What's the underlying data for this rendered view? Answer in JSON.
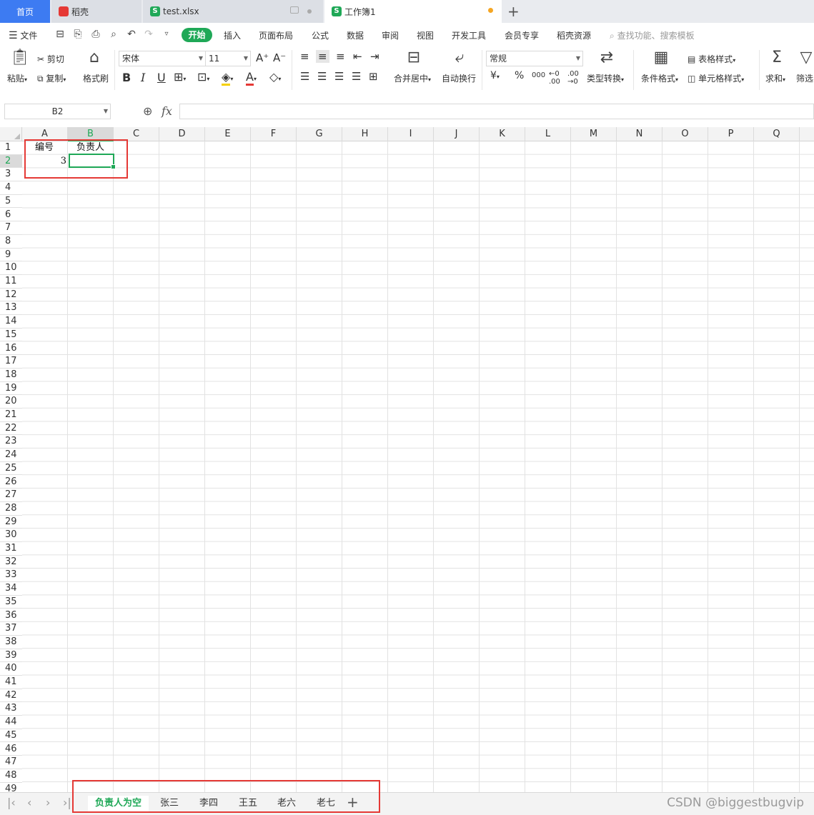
{
  "window_tabs": [
    {
      "label": "首页",
      "icon": "",
      "active": false
    },
    {
      "label": "稻壳",
      "icon": "daoke-icon",
      "active": false
    },
    {
      "label": "test.xlsx",
      "icon": "spreadsheet-icon",
      "active": false
    },
    {
      "label": "工作簿1",
      "icon": "spreadsheet-icon",
      "active": true,
      "unsaved_dot_color": "#f5a623"
    }
  ],
  "menu": {
    "file_label": "文件",
    "start_label": "开始",
    "items": [
      "插入",
      "页面布局",
      "公式",
      "数据",
      "审阅",
      "视图",
      "开发工具",
      "会员专享",
      "稻壳资源"
    ],
    "search_placeholder": "查找功能、搜索模板"
  },
  "ribbon": {
    "paste": "粘贴",
    "cut": "剪切",
    "copy": "复制",
    "format_painter": "格式刷",
    "font_name": "宋体",
    "font_size": "11",
    "merge_center": "合并居中",
    "wrap_text": "自动换行",
    "number_format": "常规",
    "type_convert": "类型转换",
    "conditional_format": "条件格式",
    "table_style": "表格样式",
    "cell_style": "单元格样式",
    "sum": "求和",
    "filter": "筛选"
  },
  "formula_bar": {
    "name_box": "B2",
    "fx": "fx",
    "value": ""
  },
  "columns": [
    "A",
    "B",
    "C",
    "D",
    "E",
    "F",
    "G",
    "H",
    "I",
    "J",
    "K",
    "L",
    "M",
    "N",
    "O",
    "P",
    "Q"
  ],
  "selected_column": "B",
  "selected_row": 2,
  "row_count": 49,
  "cells": {
    "A1": "编号",
    "B1": "负责人",
    "A2": "3"
  },
  "sheets": [
    "负责人为空",
    "张三",
    "李四",
    "王五",
    "老六",
    "老七"
  ],
  "active_sheet": "负责人为空",
  "watermark": "CSDN @biggestbugvip",
  "colors": {
    "accent": "#1fa857",
    "highlight_box": "#e53935",
    "home_tab": "#3d7bf2"
  }
}
